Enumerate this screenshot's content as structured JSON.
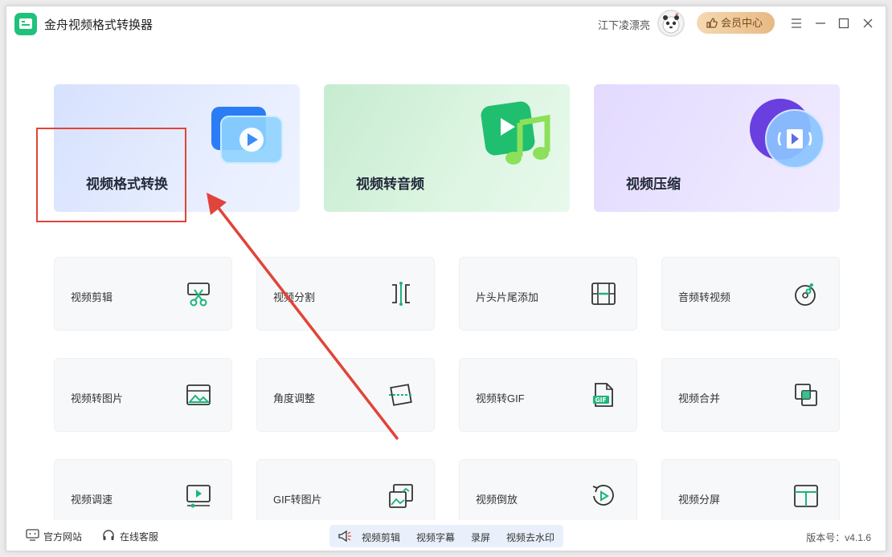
{
  "app": {
    "title": "金舟视频格式转换器",
    "brand_color": "#1fc27a"
  },
  "header": {
    "username": "江下凌漂亮",
    "vip_label": "会员中心"
  },
  "feature_cards": [
    {
      "label": "视频格式转换"
    },
    {
      "label": "视频转音频"
    },
    {
      "label": "视频压缩"
    }
  ],
  "tools": [
    {
      "label": "视频剪辑",
      "icon": "scissors-icon"
    },
    {
      "label": "视频分割",
      "icon": "split-icon"
    },
    {
      "label": "片头片尾添加",
      "icon": "film-icon"
    },
    {
      "label": "音频转视频",
      "icon": "music-disc-icon"
    },
    {
      "label": "视频转图片",
      "icon": "image-icon"
    },
    {
      "label": "角度调整",
      "icon": "rotate-frame-icon"
    },
    {
      "label": "视频转GIF",
      "icon": "gif-file-icon"
    },
    {
      "label": "视频合并",
      "icon": "merge-icon"
    },
    {
      "label": "视频调速",
      "icon": "speed-screen-icon"
    },
    {
      "label": "GIF转图片",
      "icon": "gif-image-icon"
    },
    {
      "label": "视频倒放",
      "icon": "reverse-play-icon"
    },
    {
      "label": "视频分屏",
      "icon": "split-screen-icon"
    }
  ],
  "footer": {
    "website": "官方网站",
    "support": "在线客服",
    "promo_items": [
      "视频剪辑",
      "视频字幕",
      "录屏",
      "视频去水印"
    ],
    "version": "版本号：v4.1.6"
  },
  "colors": {
    "annotation": "#e0443a",
    "icon_green": "#1db57a"
  }
}
